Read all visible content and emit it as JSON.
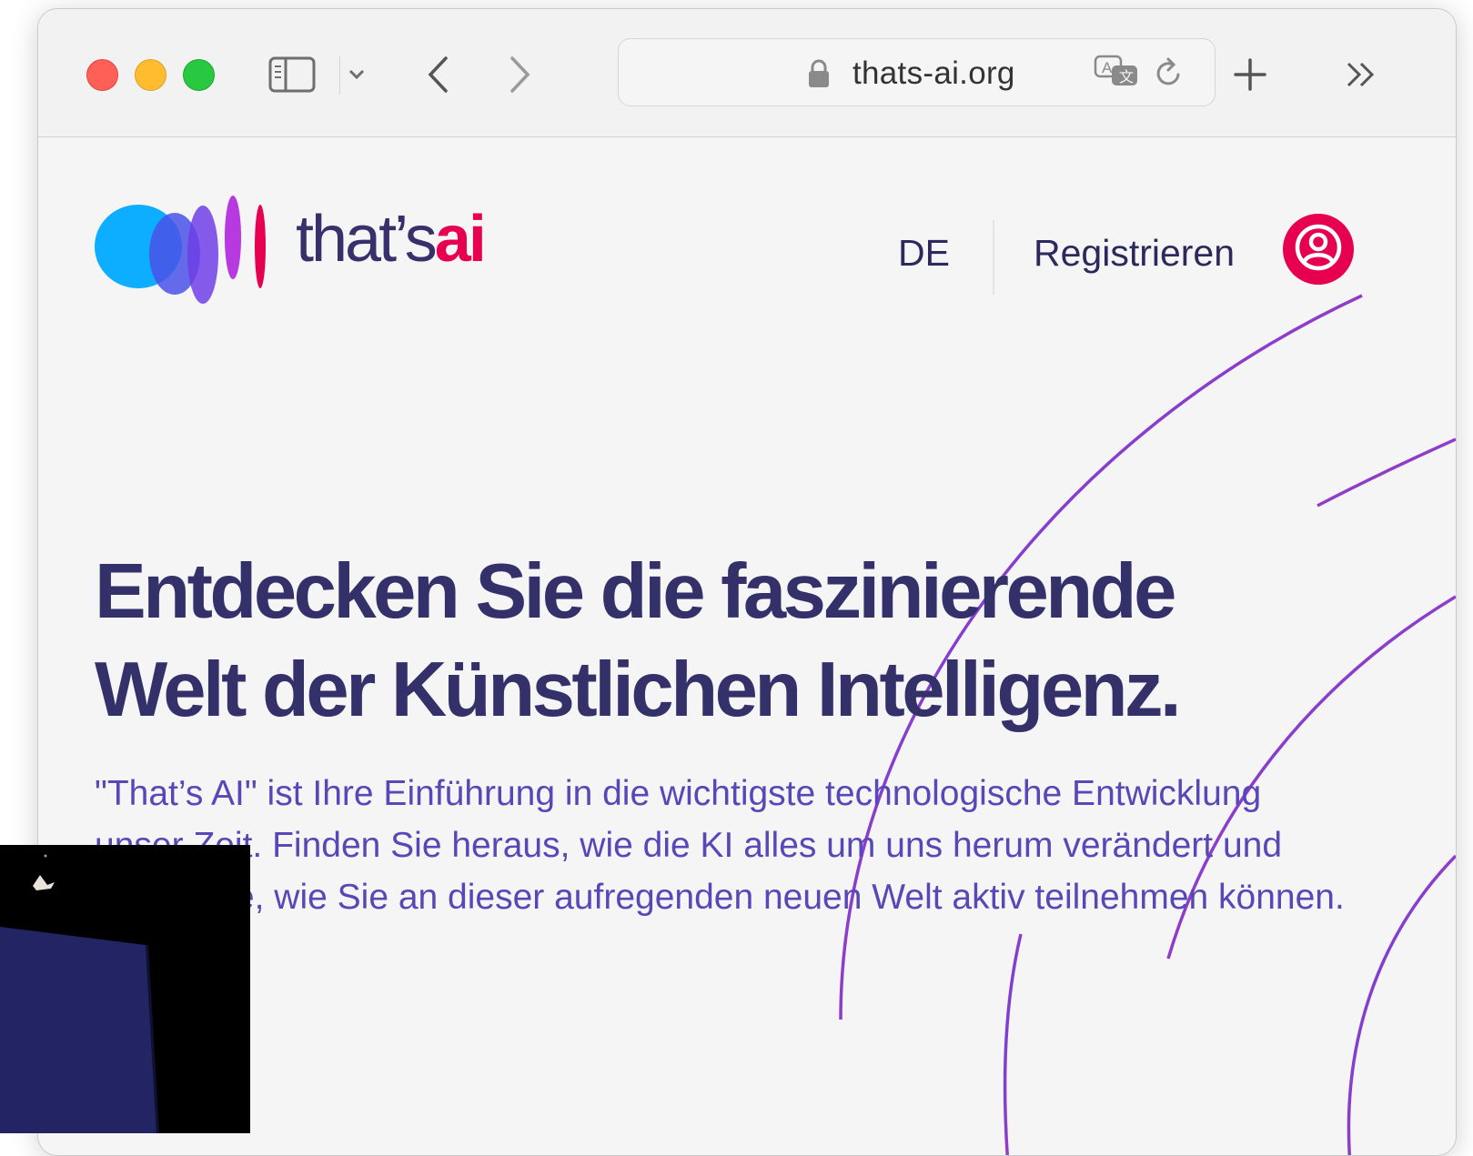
{
  "browser": {
    "url": "thats-ai.org",
    "icons": {
      "sidebar": "sidebar-icon",
      "chevron": "chevron-down-icon",
      "back": "back-arrow-icon",
      "forward": "forward-arrow-icon",
      "lock": "lock-icon",
      "translate": "translate-icon",
      "reload": "reload-icon",
      "new_tab": "plus-icon",
      "overflow": "double-chevron-right-icon"
    }
  },
  "site": {
    "logo": {
      "word": "that’s",
      "accent": "ai"
    },
    "nav": {
      "language": "DE",
      "register": "Registrieren"
    },
    "hero": {
      "headline": "Entdecken Sie die faszinierende Welt der Künstlichen Intelligenz.",
      "intro": "\"That’s AI\" ist Ihre Einführung in die wichtigste technologische Entwicklung unser Zeit. Finden Sie heraus, wie die KI alles um uns herum verändert und lernen Sie, wie Sie an dieser aufregenden neuen Welt aktiv teilnehmen können."
    }
  },
  "colors": {
    "brand_dark": "#33306a",
    "brand_accent": "#e6004f",
    "intro_text": "#5747b7",
    "arc_start": "#6b3fe0",
    "arc_end": "#b43bb0"
  }
}
